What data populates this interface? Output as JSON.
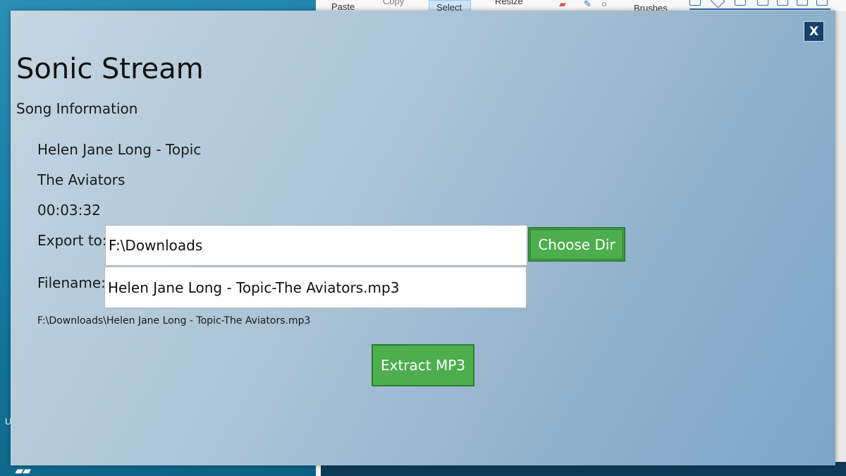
{
  "background": {
    "ribbon": {
      "paste_label": "Paste",
      "copy_label": "Copy",
      "select_label": "Select",
      "resize_label": "Resize",
      "brushes_label": "Brushes"
    },
    "desktop_fragments": [
      "U"
    ]
  },
  "dialog": {
    "close_label": "X",
    "app_title": "Sonic Stream",
    "section_title": "Song Information",
    "song": {
      "artist": "Helen Jane Long - Topic",
      "title": "The Aviators",
      "duration": "00:03:32"
    },
    "export": {
      "label": "Export to:",
      "value": "F:\\Downloads",
      "choose_button": "Choose Dir"
    },
    "filename": {
      "label": "Filename:",
      "value": "Helen Jane Long - Topic-The Aviators.mp3"
    },
    "full_path": "F:\\Downloads\\Helen Jane Long - Topic-The Aviators.mp3",
    "extract_button": "Extract MP3"
  },
  "colors": {
    "accent_green": "#4cae4c",
    "close_button": "#17406b",
    "dialog_gradient_start": "#c4d6e1",
    "dialog_gradient_end": "#7ea5c7"
  }
}
